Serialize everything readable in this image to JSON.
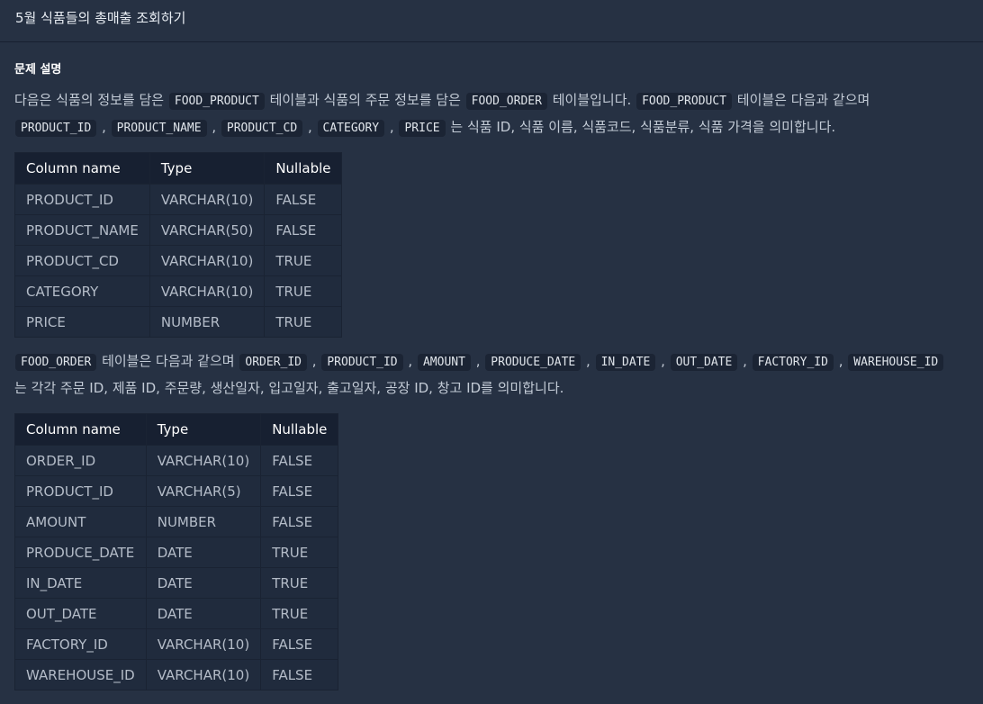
{
  "header": {
    "title": "5월 식품들의 총매출 조회하기"
  },
  "section": {
    "title": "문제 설명"
  },
  "para1": {
    "text1": "다음은 식품의 정보를 담은",
    "code1": "FOOD_PRODUCT",
    "text2": "테이블과 식품의 주문 정보를 담은",
    "code2": "FOOD_ORDER",
    "text3": "테이블입니다.",
    "code3": "FOOD_PRODUCT",
    "text4": "테이블은 다음과 같으며",
    "columns": [
      "PRODUCT_ID",
      "PRODUCT_NAME",
      "PRODUCT_CD",
      "CATEGORY",
      "PRICE"
    ],
    "sep": ",",
    "text5": "는 식품 ID, 식품 이름, 식품코드, 식품분류, 식품 가격을 의미합니다."
  },
  "table1": {
    "headers": [
      "Column name",
      "Type",
      "Nullable"
    ],
    "rows": [
      [
        "PRODUCT_ID",
        "VARCHAR(10)",
        "FALSE"
      ],
      [
        "PRODUCT_NAME",
        "VARCHAR(50)",
        "FALSE"
      ],
      [
        "PRODUCT_CD",
        "VARCHAR(10)",
        "TRUE"
      ],
      [
        "CATEGORY",
        "VARCHAR(10)",
        "TRUE"
      ],
      [
        "PRICE",
        "NUMBER",
        "TRUE"
      ]
    ]
  },
  "para2": {
    "code1": "FOOD_ORDER",
    "text1": "테이블은 다음과 같으며",
    "columns": [
      "ORDER_ID",
      "PRODUCT_ID",
      "AMOUNT",
      "PRODUCE_DATE",
      "IN_DATE",
      "OUT_DATE",
      "FACTORY_ID",
      "WAREHOUSE_ID"
    ],
    "sep": ",",
    "text2": "는 각각 주문 ID, 제품 ID, 주문량, 생산일자, 입고일자, 출고일자, 공장 ID, 창고 ID를 의미합니다."
  },
  "table2": {
    "headers": [
      "Column name",
      "Type",
      "Nullable"
    ],
    "rows": [
      [
        "ORDER_ID",
        "VARCHAR(10)",
        "FALSE"
      ],
      [
        "PRODUCT_ID",
        "VARCHAR(5)",
        "FALSE"
      ],
      [
        "AMOUNT",
        "NUMBER",
        "FALSE"
      ],
      [
        "PRODUCE_DATE",
        "DATE",
        "TRUE"
      ],
      [
        "IN_DATE",
        "DATE",
        "TRUE"
      ],
      [
        "OUT_DATE",
        "DATE",
        "TRUE"
      ],
      [
        "FACTORY_ID",
        "VARCHAR(10)",
        "FALSE"
      ],
      [
        "WAREHOUSE_ID",
        "VARCHAR(10)",
        "FALSE"
      ]
    ]
  }
}
